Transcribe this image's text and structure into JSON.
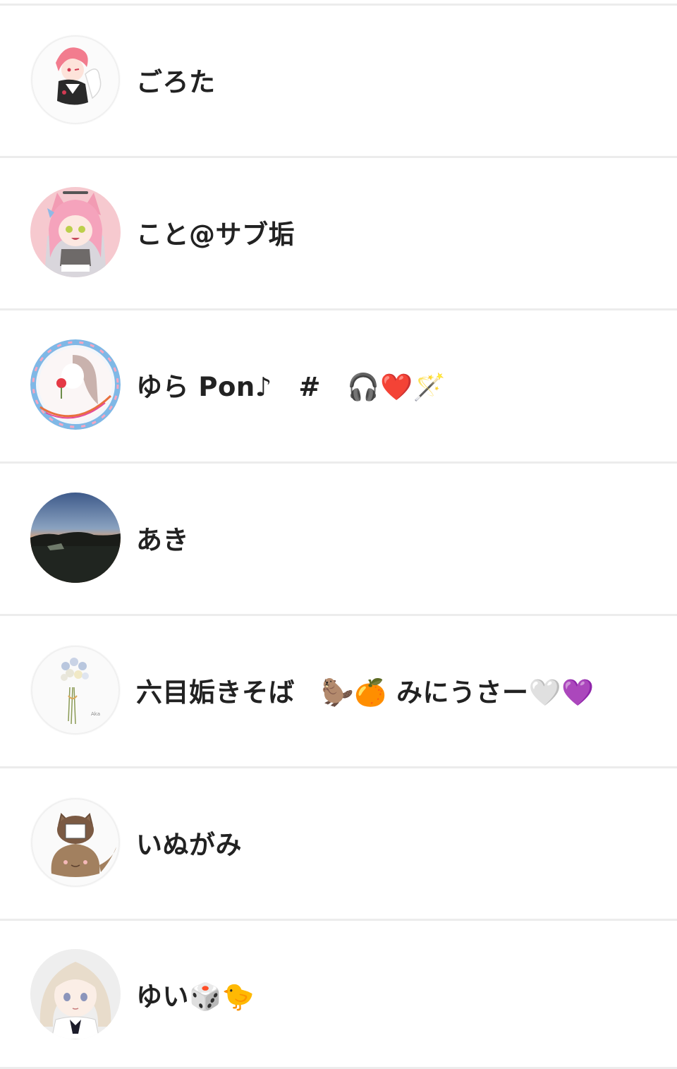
{
  "users": [
    {
      "name": "ごろた",
      "avatar_icon": "pink-hair-character-avatar"
    },
    {
      "name": "こと@サブ垢",
      "avatar_icon": "pink-cat-ear-girl-avatar"
    },
    {
      "name": "ゆら Pon♪　#　🎧❤️🪄",
      "avatar_icon": "summer-tour-badge-avatar"
    },
    {
      "name": "あき",
      "avatar_icon": "sunset-landscape-avatar"
    },
    {
      "name": "六目姤きそば　🦫🍊 みにうさー🤍💜",
      "avatar_icon": "flower-bouquet-avatar"
    },
    {
      "name": "いぬがみ",
      "avatar_icon": "dog-character-avatar"
    },
    {
      "name": "ゆい🎲🐤",
      "avatar_icon": "blonde-girl-avatar"
    }
  ],
  "colors": {
    "divider": "#ececec",
    "name_text": "#222222",
    "background": "#ffffff"
  }
}
